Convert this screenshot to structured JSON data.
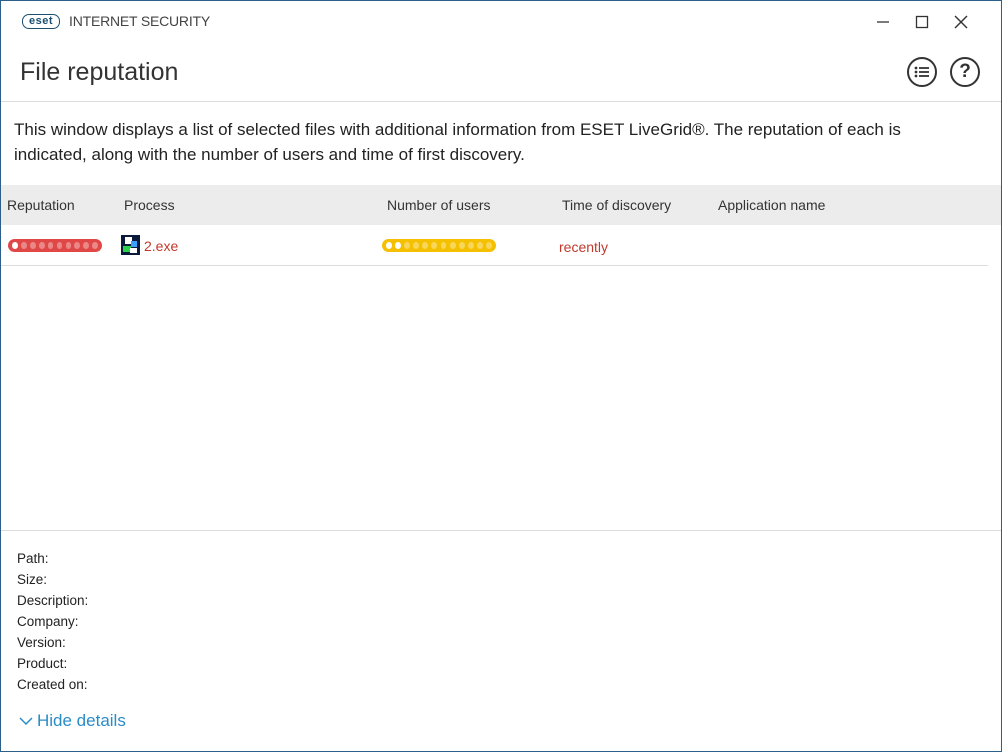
{
  "app": {
    "logo": "eset",
    "product": "INTERNET SECURITY"
  },
  "page": {
    "title": "File reputation",
    "description": "This window displays a list of selected files with additional information from ESET LiveGrid®. The reputation of each is indicated, along with the number of users and time of first discovery."
  },
  "table": {
    "columns": [
      "Reputation",
      "Process",
      "Number of users",
      "Time of discovery",
      "Application name"
    ],
    "rows": [
      {
        "reputation_level": 1,
        "reputation_max": 10,
        "reputation_color": "#e04848",
        "process": "2.exe",
        "users_level": 2,
        "users_max": 12,
        "users_color": "#f5c000",
        "time": "recently",
        "application": ""
      }
    ]
  },
  "details": {
    "path": "Path:",
    "size": "Size:",
    "description": "Description:",
    "company": "Company:",
    "version": "Version:",
    "product": "Product:",
    "created": "Created on:"
  },
  "hide_details": "Hide details",
  "colors": {
    "accent": "#2a8cc7",
    "danger_text": "#c0392b"
  }
}
